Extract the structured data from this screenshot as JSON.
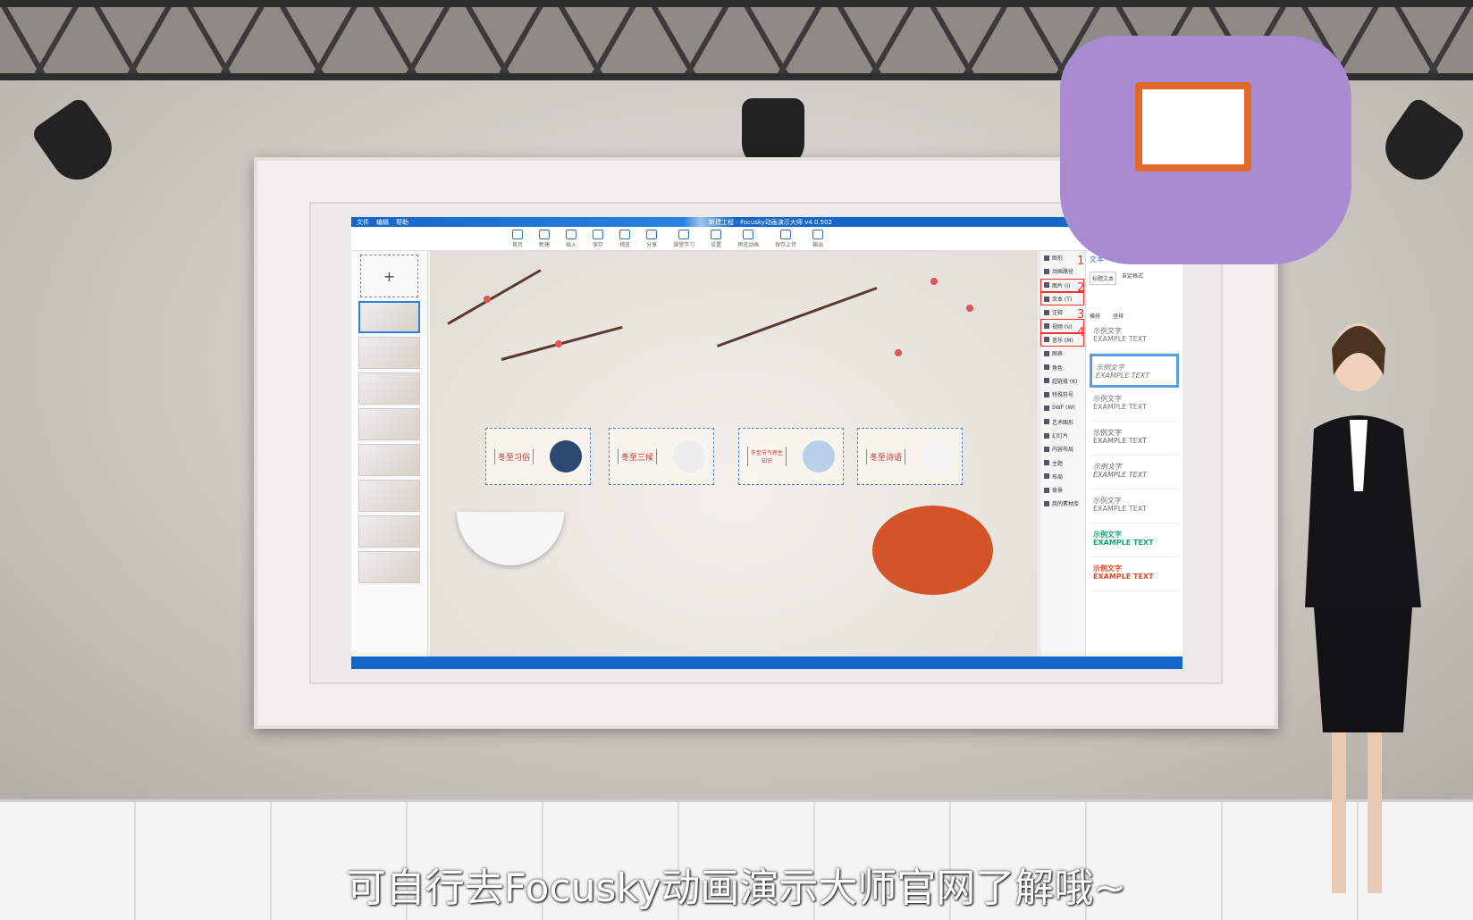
{
  "app": {
    "menu": [
      "文件",
      "编辑",
      "帮助"
    ],
    "title": "新建工程 - Focusky动画演示大师 v4.0.502",
    "toolbar": [
      "首页",
      "新建",
      "插入",
      "保存",
      "预览",
      "分享",
      "课堂学习",
      "设置",
      "预览动画",
      "保存上传",
      "输出"
    ],
    "tools": [
      "图形",
      "动画路径",
      "图片 (I)",
      "文本 (T)",
      "注释",
      "视频 (V)",
      "音乐 (M)",
      "图表",
      "角色",
      "超链接 (K)",
      "特殊符号",
      "SWF (W)",
      "艺术图形",
      "幻灯片",
      "内容布局",
      "主题",
      "布局",
      "背景",
      "我的素材库"
    ],
    "annotations": [
      "1",
      "2",
      "3",
      "4"
    ],
    "cards": [
      "冬至习俗",
      "冬至三候",
      "冬至节气养生知识",
      "冬至诗语"
    ],
    "panel": {
      "title": "文本",
      "tab": "标题文本",
      "checkbox": "自定格式",
      "options": [
        "横排",
        "竖排"
      ],
      "sample_cn": "示例文字",
      "sample_en": "EXAMPLE TEXT"
    },
    "accent": "#1466c8"
  },
  "subtitle": "可自行去Focusky动画演示大师官网了解哦~"
}
